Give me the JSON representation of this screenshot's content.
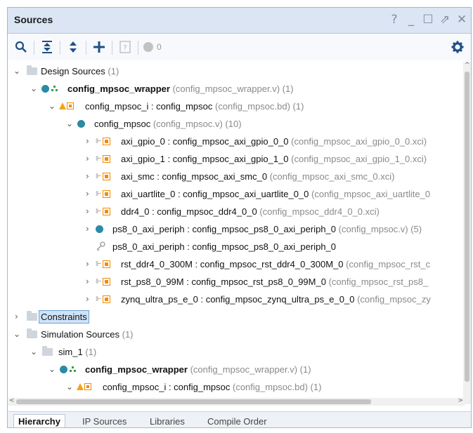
{
  "window": {
    "title": "Sources",
    "controls": [
      "?",
      "_",
      "☐",
      "⇗",
      "✕"
    ]
  },
  "toolbar": {
    "error_count": "0"
  },
  "tree": [
    {
      "name": "Design Sources",
      "meta": "(1)"
    },
    {
      "name": "config_mpsoc_wrapper",
      "meta": "(config_mpsoc_wrapper.v) (1)"
    },
    {
      "name": "config_mpsoc_i : config_mpsoc",
      "meta": "(config_mpsoc.bd) (1)"
    },
    {
      "name": "config_mpsoc",
      "meta": "(config_mpsoc.v) (10)"
    },
    {
      "name": "axi_gpio_0 : config_mpsoc_axi_gpio_0_0",
      "meta": "(config_mpsoc_axi_gpio_0_0.xci)"
    },
    {
      "name": "axi_gpio_1 : config_mpsoc_axi_gpio_1_0",
      "meta": "(config_mpsoc_axi_gpio_1_0.xci)"
    },
    {
      "name": "axi_smc : config_mpsoc_axi_smc_0",
      "meta": "(config_mpsoc_axi_smc_0.xci)"
    },
    {
      "name": "axi_uartlite_0 : config_mpsoc_axi_uartlite_0_0",
      "meta": "(config_mpsoc_axi_uartlite_0"
    },
    {
      "name": "ddr4_0 : config_mpsoc_ddr4_0_0",
      "meta": "(config_mpsoc_ddr4_0_0.xci)"
    },
    {
      "name": "ps8_0_axi_periph : config_mpsoc_ps8_0_axi_periph_0",
      "meta": "(config_mpsoc.v) (5)"
    },
    {
      "name": "ps8_0_axi_periph : config_mpsoc_ps8_0_axi_periph_0",
      "meta": ""
    },
    {
      "name": "rst_ddr4_0_300M : config_mpsoc_rst_ddr4_0_300M_0",
      "meta": "(config_mpsoc_rst_c"
    },
    {
      "name": "rst_ps8_0_99M : config_mpsoc_rst_ps8_0_99M_0",
      "meta": "(config_mpsoc_rst_ps8_"
    },
    {
      "name": "zynq_ultra_ps_e_0 : config_mpsoc_zynq_ultra_ps_e_0_0",
      "meta": "(config_mpsoc_zy"
    },
    {
      "name": "Constraints",
      "meta": ""
    },
    {
      "name": "Simulation Sources",
      "meta": "(1)"
    },
    {
      "name": "sim_1",
      "meta": "(1)"
    },
    {
      "name": "config_mpsoc_wrapper",
      "meta": "(config_mpsoc_wrapper.v) (1)"
    },
    {
      "name": "config_mpsoc_i : config_mpsoc",
      "meta": "(config_mpsoc.bd) (1)"
    }
  ],
  "tabs": [
    "Hierarchy",
    "IP Sources",
    "Libraries",
    "Compile Order"
  ],
  "colors": {
    "accent": "#1e4f86",
    "title_bg": "#dbe5f3",
    "selection": "#cfe3f7"
  }
}
